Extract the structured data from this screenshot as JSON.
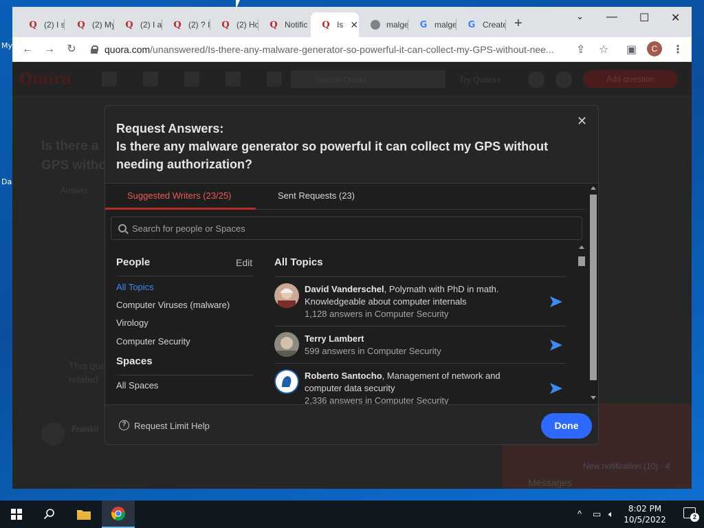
{
  "desktop": {
    "labels": [
      "My",
      "Da"
    ]
  },
  "browser": {
    "tabs": [
      {
        "label": "(2) I s",
        "favicon": "quora-q-red"
      },
      {
        "label": "(2) My",
        "favicon": "quora-q-red"
      },
      {
        "label": "(2) I a",
        "favicon": "quora-q-red"
      },
      {
        "label": "(2) ? I",
        "favicon": "quora-q-red"
      },
      {
        "label": "(2) Ho",
        "favicon": "quora-q-red"
      },
      {
        "label": "Notific",
        "favicon": "quora-q"
      },
      {
        "label": "Is",
        "favicon": "quora-q",
        "active": true
      },
      {
        "label": "malge",
        "favicon": "globe"
      },
      {
        "label": "malge",
        "favicon": "google-g"
      },
      {
        "label": "Create",
        "favicon": "google-g"
      }
    ],
    "url_host": "quora.com",
    "url_path": "/unanswered/Is-there-any-malware-generator-so-powerful-it-can-collect-my-GPS-without-nee...",
    "profile_initial": "C"
  },
  "modal": {
    "title_line1": "Request Answers:",
    "title_line2": "Is there any malware generator so powerful it can collect my GPS without needing authorization?",
    "tab_suggested": "Suggested Writers (23/25)",
    "tab_sent": "Sent Requests (23)",
    "search_placeholder": "Search for people or Spaces",
    "people_heading": "People",
    "edit_label": "Edit",
    "topics": [
      "All Topics",
      "Computer Viruses (malware)",
      "Virology",
      "Computer Security"
    ],
    "spaces_heading": "Spaces",
    "spaces_items": [
      "All Spaces"
    ],
    "all_topics_heading": "All Topics",
    "writers": [
      {
        "name": "David Vanderschel",
        "bio": ", Polymath with PhD in math. Knowledgeable about computer internals",
        "stats": "1,128 answers in Computer Security"
      },
      {
        "name": "Terry Lambert",
        "bio": "",
        "stats": "599 answers in Computer Security"
      },
      {
        "name": "Roberto Santocho",
        "bio": ", Management of network and computer data security",
        "stats": "2,336 answers in Computer Security"
      }
    ],
    "help_text": "Request Limit Help",
    "done_label": "Done"
  },
  "page_bg": {
    "question_fragment_1": "Is there a",
    "question_fragment_2": "GPS witho",
    "answer_label": "Answer",
    "search_label": "Search Quora",
    "try_label": "Try Quora+",
    "add_question": "Add question",
    "snippet_1": "This que",
    "snippet_2": "related",
    "user_name": "Frankli",
    "messages_label": "Messages",
    "new_notification": "New notification (10) · 4"
  },
  "taskbar": {
    "time": "8:02 PM",
    "date": "10/5/2022",
    "notification_count": "2"
  },
  "colors": {
    "quora_red": "#b92b27",
    "accent_blue": "#2e69ff",
    "link_blue": "#3b8af5",
    "modal_bg": "#262626"
  }
}
